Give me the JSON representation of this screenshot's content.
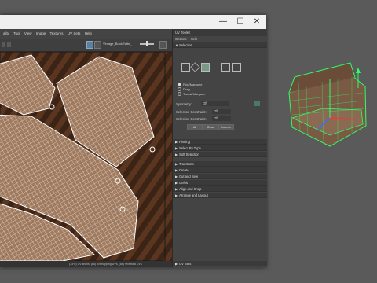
{
  "window": {
    "controls": [
      "—",
      "☐",
      "✕"
    ]
  },
  "uv_editor": {
    "menu": [
      "ality",
      "Tool",
      "View",
      "Image",
      "Textures",
      "UV Sets",
      "Help"
    ],
    "toolbar": {
      "image_name": "Vintage_BookRatte_"
    },
    "status_text": "(35%) UV shells, (88) overlapping UVs, (88) reversed UVs"
  },
  "toolkit": {
    "title": "UV Toolkit",
    "menu": [
      "Options",
      "Help"
    ],
    "selection_header": "Selection",
    "pick_modes": [
      "Pick/Marquee",
      "Drag",
      "Tweak/Marquee"
    ],
    "symmetry_label": "Symmetry:",
    "symmetry_value": "Off",
    "sel_constraint_1_label": "Selection Constraint:",
    "sel_constraint_1_value": "Off",
    "sel_constraint_2_label": "Selection Constraint:",
    "sel_constraint_2_value": "Off",
    "buttons": [
      "All",
      "Clear",
      "Inverse"
    ],
    "sections": [
      "Pinning",
      "Select By Type",
      "Soft Selection",
      "Transform",
      "Create",
      "Cut and Sew",
      "Unfold",
      "Align and Snap",
      "Arrange and Layout"
    ],
    "footer_section": "UV Sets"
  },
  "colors": {
    "wire": "#ffffff",
    "sofa_wire": "#2bff6a",
    "accent": "#4aa3ff"
  }
}
